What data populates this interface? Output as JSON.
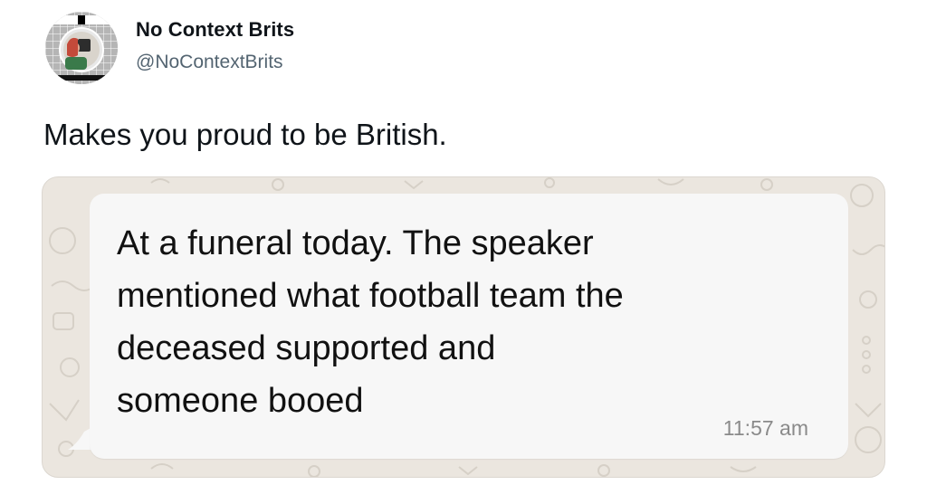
{
  "author": {
    "name": "No Context Brits",
    "handle": "@NoContextBrits",
    "avatar_icon": "profile-avatar-icon"
  },
  "tweet": {
    "text": "Makes you proud to be British."
  },
  "message": {
    "text": "At a funeral today. The speaker\nmentioned what football team the\ndeceased supported and\nsomeone booed",
    "time": "11:57 am"
  },
  "colors": {
    "text_primary": "#0f1419",
    "text_secondary": "#536471",
    "chat_background": "#ebe6df",
    "bubble": "#f7f7f7"
  }
}
